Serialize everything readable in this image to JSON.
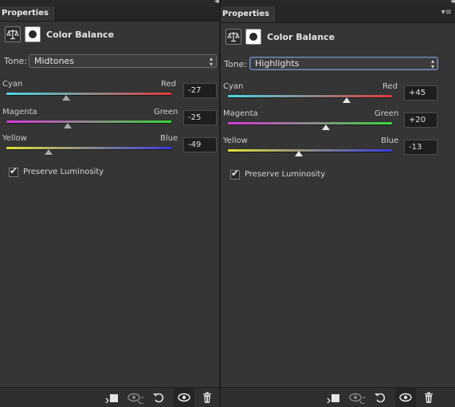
{
  "panels": [
    {
      "tab_label": "Properties",
      "header_title": "Color Balance",
      "tone_label": "Tone:",
      "tone_value": "Midtones",
      "sliders": [
        {
          "left": "Cyan",
          "right": "Red",
          "value": "-27"
        },
        {
          "left": "Magenta",
          "right": "Green",
          "value": "-25"
        },
        {
          "left": "Yellow",
          "right": "Blue",
          "value": "-49"
        }
      ],
      "preserve_luminosity": "Preserve Luminosity"
    },
    {
      "tab_label": "Properties",
      "header_title": "Color Balance",
      "tone_label": "Tone:",
      "tone_value": "Highlights",
      "sliders": [
        {
          "left": "Cyan",
          "right": "Red",
          "value": "+45"
        },
        {
          "left": "Magenta",
          "right": "Green",
          "value": "+20"
        },
        {
          "left": "Yellow",
          "right": "Blue",
          "value": "-13"
        }
      ],
      "preserve_luminosity": "Preserve Luminosity"
    }
  ],
  "icons": {
    "collapse": "double-chevron-left-icon",
    "panel_menu": "panel-menu-icon",
    "adjustment": "balance-scale-icon",
    "mask": "mask-icon",
    "clip": "clip-to-layer-icon",
    "view_previous": "view-previous-state-icon",
    "reset": "reset-icon",
    "visibility": "eye-icon",
    "delete": "trash-icon"
  }
}
